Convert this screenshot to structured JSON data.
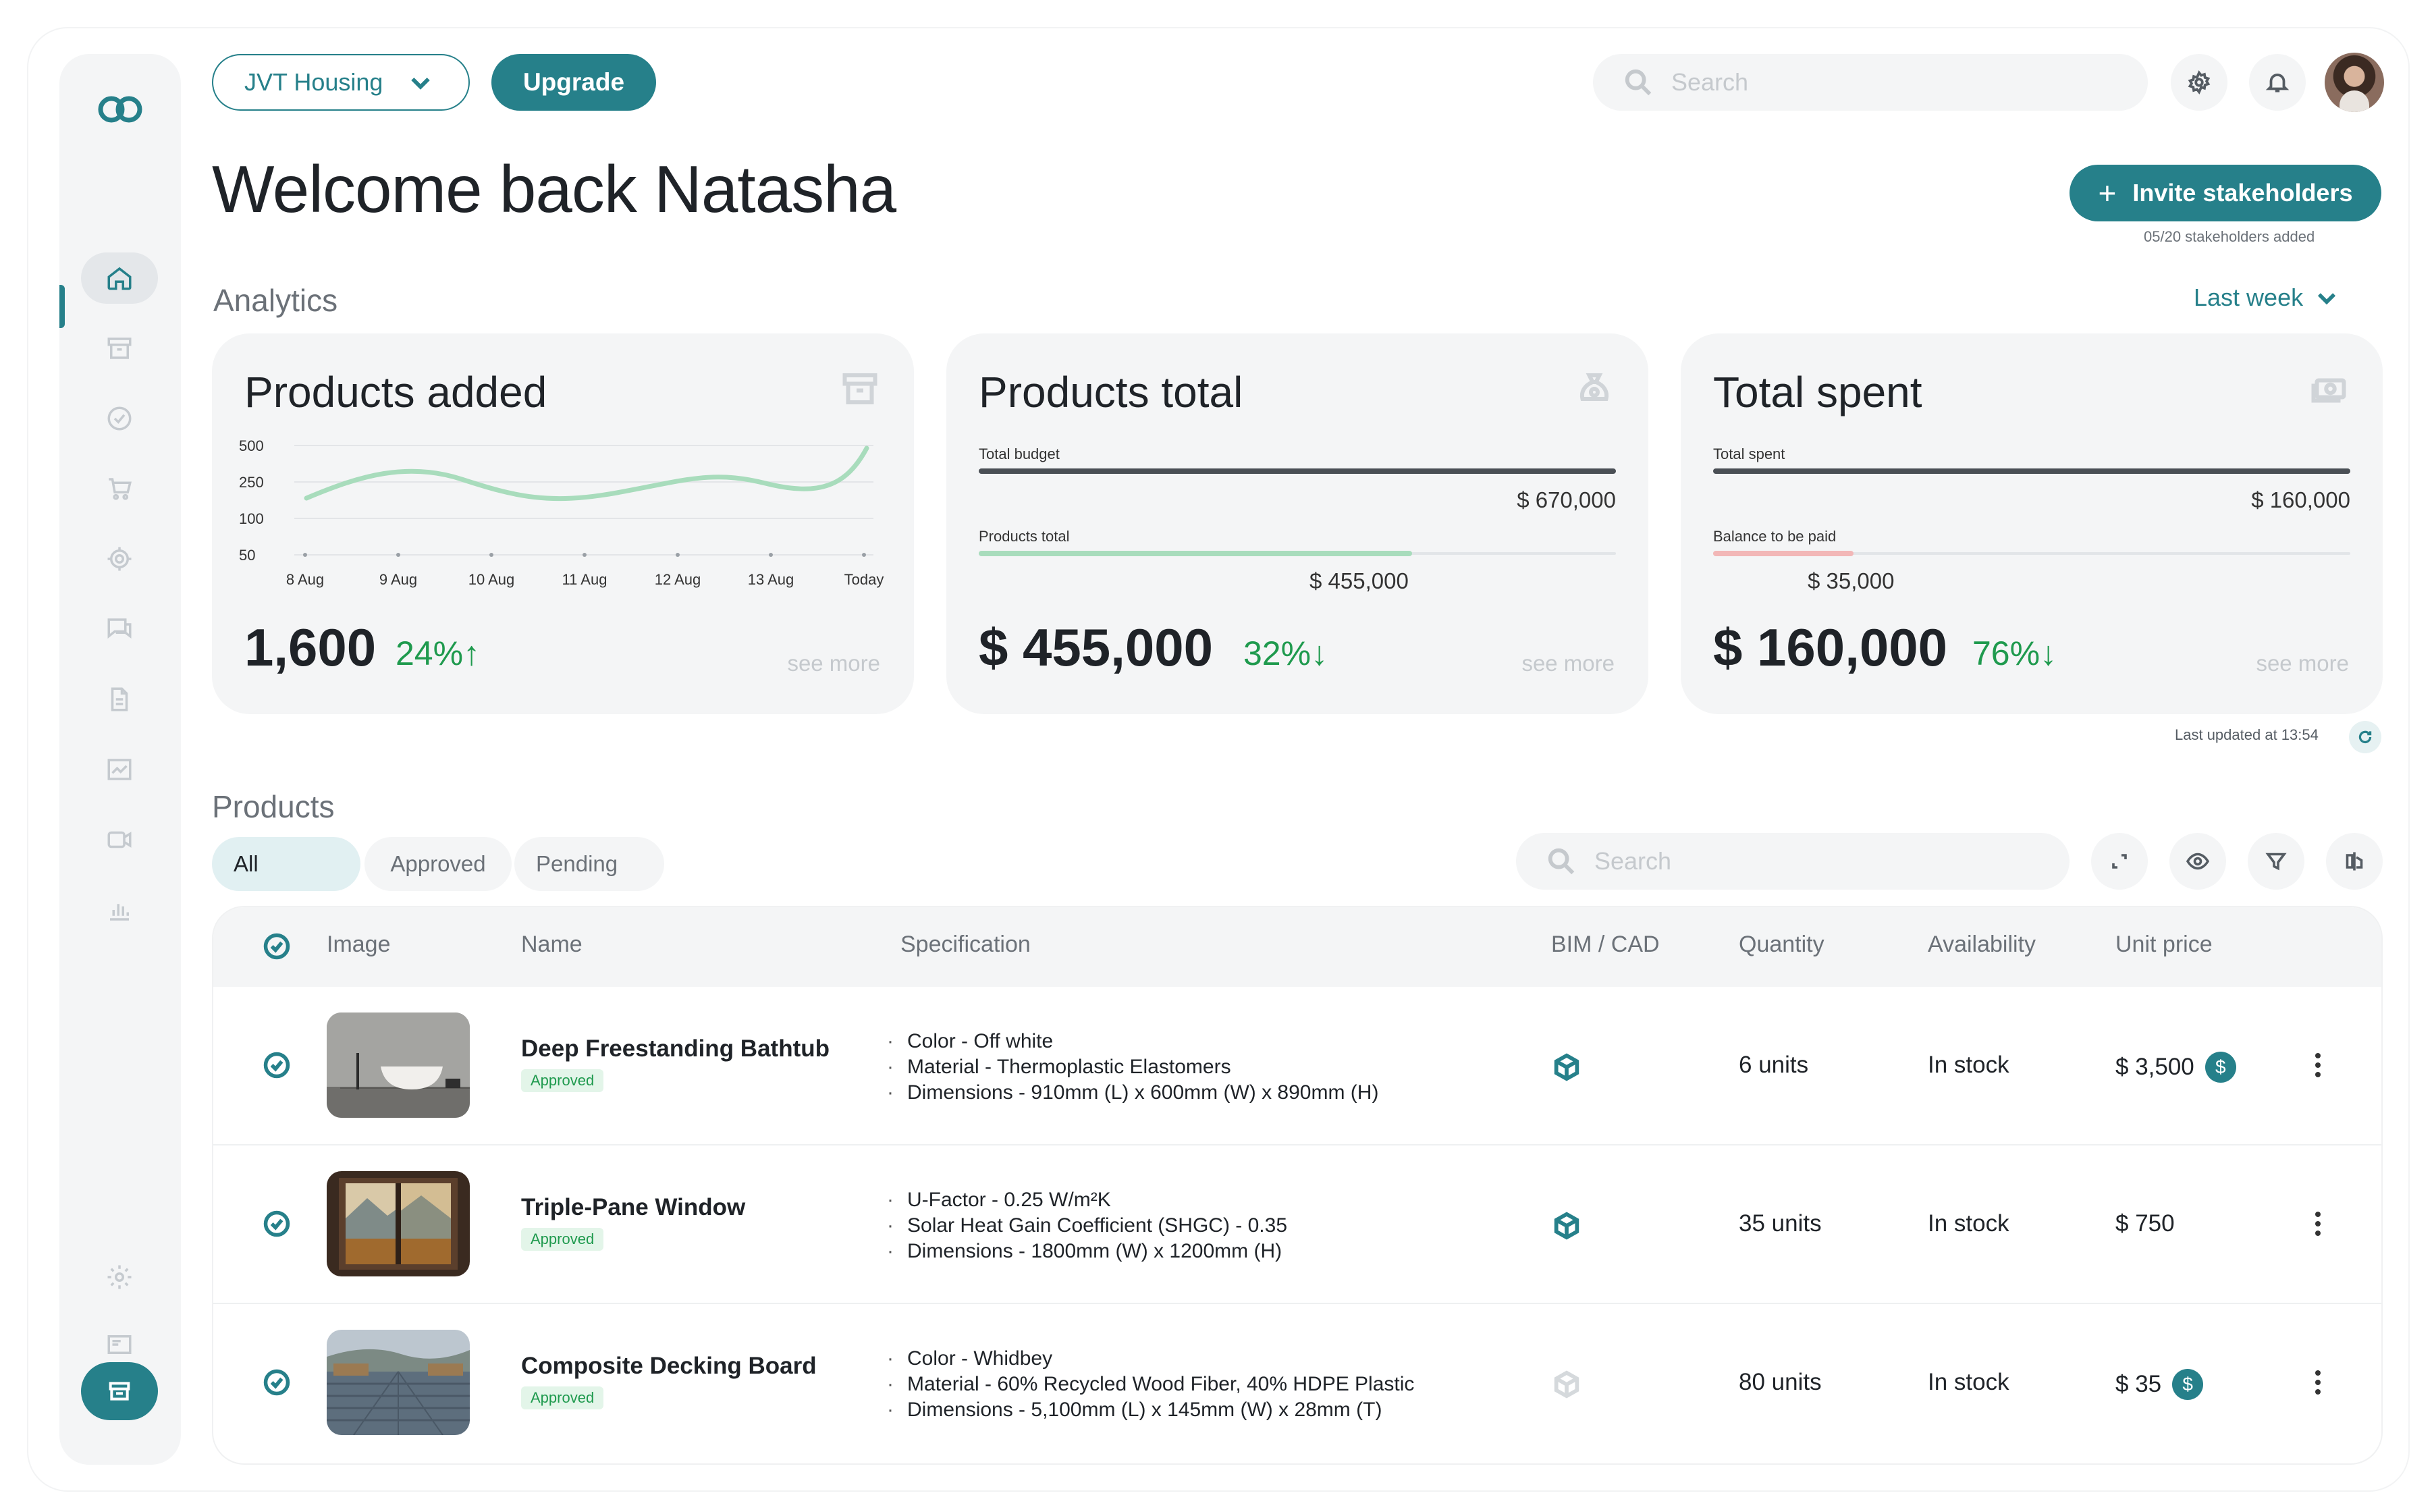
{
  "workspace": {
    "name": "JVT Housing"
  },
  "topbar": {
    "upgrade_label": "Upgrade",
    "search_placeholder": "Search"
  },
  "welcome": "Welcome back Natasha",
  "invite": {
    "label": "Invite stakeholders",
    "note": "05/20 stakeholders added"
  },
  "analytics": {
    "title": "Analytics",
    "period": "Last week",
    "last_updated": "Last updated at 13:54",
    "cards": [
      {
        "title": "Products added",
        "icon": "archive-icon",
        "value": "1,600",
        "delta": "24%↑",
        "see_more": "see more",
        "chart": {
          "y_ticks": [
            "500",
            "250",
            "100",
            "50"
          ],
          "x_ticks": [
            "8 Aug",
            "9 Aug",
            "10 Aug",
            "11 Aug",
            "12 Aug",
            "13 Aug",
            "Today"
          ]
        }
      },
      {
        "title": "Products total",
        "icon": "coin-bag-icon",
        "bar1_label": "Total budget",
        "bar1_value": "$ 670,000",
        "bar1_fraction": 1.0,
        "bar2_label": "Products total",
        "bar2_value": "$ 455,000",
        "bar2_fraction": 0.68,
        "value": "$ 455,000",
        "delta": "32%↓",
        "see_more": "see more"
      },
      {
        "title": "Total spent",
        "icon": "money-icon",
        "bar1_label": "Total spent",
        "bar1_value": "$ 160,000",
        "bar1_fraction": 1.0,
        "bar2_label": "Balance to be paid",
        "bar2_value": "$ 35,000",
        "bar2_fraction": 0.22,
        "value": "$ 160,000",
        "delta": "76%↓",
        "see_more": "see more"
      }
    ]
  },
  "products": {
    "title": "Products",
    "tabs": [
      "All",
      "Approved",
      "Pending"
    ],
    "search_placeholder": "Search",
    "columns": [
      "Image",
      "Name",
      "Specification",
      "BIM / CAD",
      "Quantity",
      "Availability",
      "Unit price"
    ],
    "rows": [
      {
        "name": "Deep Freestanding Bathtub",
        "status": "Approved",
        "specs": [
          "Color - Off white",
          "Material - Thermoplastic Elastomers",
          "Dimensions - 910mm (L) x 600mm (W) x 890mm (H)"
        ],
        "quantity": "6 units",
        "availability": "In stock",
        "price": "$ 3,500",
        "bim_available": true,
        "price_badge": true
      },
      {
        "name": "Triple-Pane Window",
        "status": "Approved",
        "specs": [
          "U-Factor - 0.25 W/m²K",
          "Solar Heat Gain Coefficient (SHGC) - 0.35",
          "Dimensions - 1800mm (W) x 1200mm (H)"
        ],
        "quantity": "35 units",
        "availability": "In stock",
        "price": "$ 750",
        "bim_available": true,
        "price_badge": false
      },
      {
        "name": "Composite Decking Board",
        "status": "Approved",
        "specs": [
          "Color - Whidbey",
          "Material - 60% Recycled Wood Fiber, 40% HDPE Plastic",
          "Dimensions - 5,100mm (L) x 145mm (W) x 28mm (T)"
        ],
        "quantity": "80 units",
        "availability": "In stock",
        "price": "$ 35",
        "bim_available": false,
        "price_badge": true
      }
    ],
    "price_badge_symbol": "$"
  },
  "colors": {
    "accent": "#26808a",
    "positive": "#1f9a4e",
    "chart_line": "#a8dcbc",
    "balance_bar": "#f2b7b7"
  }
}
